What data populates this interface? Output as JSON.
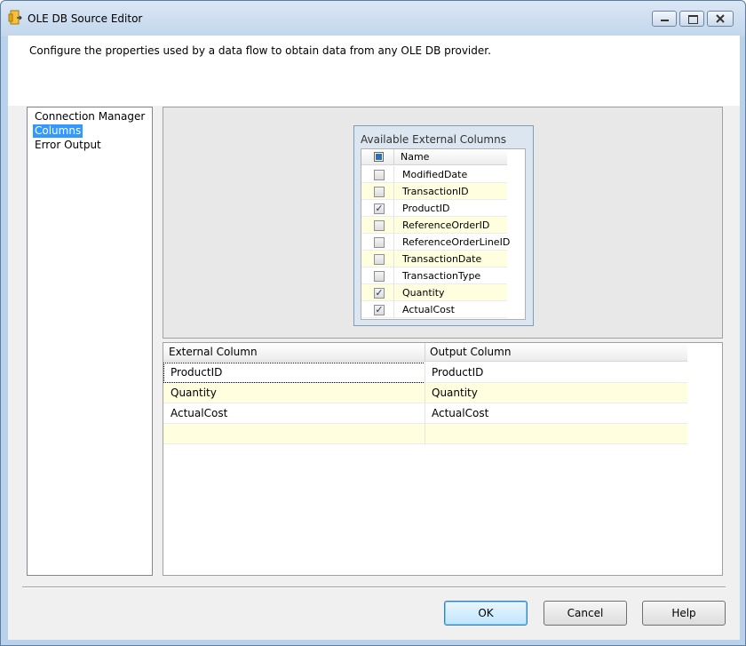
{
  "window": {
    "title": "OLE DB Source Editor"
  },
  "header": {
    "description": "Configure the properties used by a data flow to obtain data from any OLE DB provider."
  },
  "nav": {
    "items": [
      {
        "label": "Connection Manager",
        "selected": false
      },
      {
        "label": "Columns",
        "selected": true
      },
      {
        "label": "Error Output",
        "selected": false
      }
    ]
  },
  "available_columns": {
    "title": "Available External Columns",
    "header": "Name",
    "rows": [
      {
        "name": "ModifiedDate",
        "checked": false
      },
      {
        "name": "TransactionID",
        "checked": false
      },
      {
        "name": "ProductID",
        "checked": true
      },
      {
        "name": "ReferenceOrderID",
        "checked": false
      },
      {
        "name": "ReferenceOrderLineID",
        "checked": false
      },
      {
        "name": "TransactionDate",
        "checked": false
      },
      {
        "name": "TransactionType",
        "checked": false
      },
      {
        "name": "Quantity",
        "checked": true
      },
      {
        "name": "ActualCost",
        "checked": true
      }
    ]
  },
  "mapping_grid": {
    "headers": [
      "External Column",
      "Output Column"
    ],
    "rows": [
      [
        "ProductID",
        "ProductID"
      ],
      [
        "Quantity",
        "Quantity"
      ],
      [
        "ActualCost",
        "ActualCost"
      ],
      [
        "",
        ""
      ]
    ]
  },
  "buttons": {
    "ok": "OK",
    "cancel": "Cancel",
    "help": "Help"
  }
}
